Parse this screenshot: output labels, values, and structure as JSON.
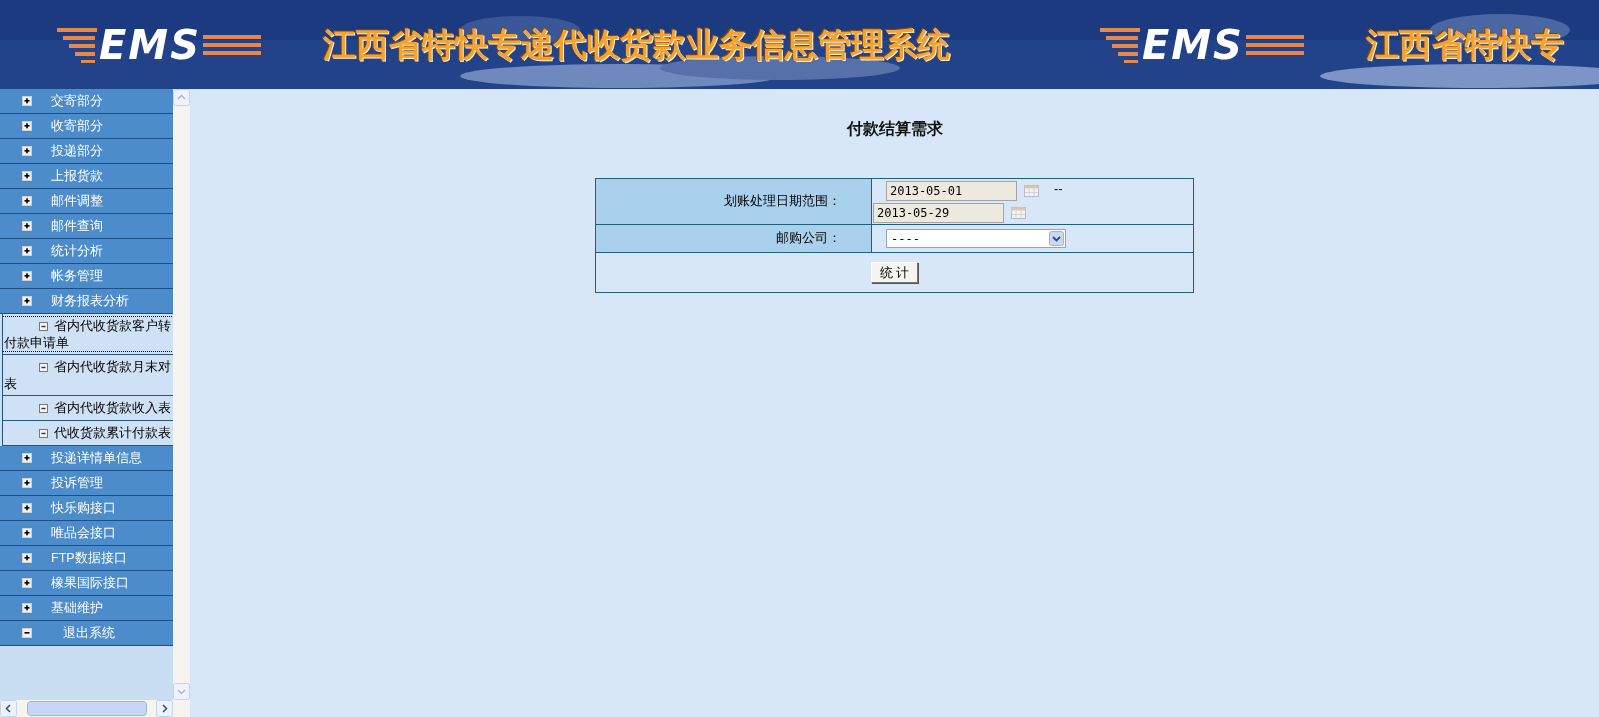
{
  "header": {
    "banners": [
      {
        "logo": "EMS",
        "title": "江西省特快专递代收货款业务信息管理系统"
      },
      {
        "logo": "EMS",
        "title": "江西省特快专"
      }
    ]
  },
  "sidebar": {
    "items": [
      {
        "label": "交寄部分",
        "expanded": false
      },
      {
        "label": "收寄部分",
        "expanded": false
      },
      {
        "label": "投递部分",
        "expanded": false
      },
      {
        "label": "上报货款",
        "expanded": false
      },
      {
        "label": "邮件调整",
        "expanded": false
      },
      {
        "label": "邮件查询",
        "expanded": false
      },
      {
        "label": "统计分析",
        "expanded": false
      },
      {
        "label": "帐务管理",
        "expanded": false
      },
      {
        "label": "财务报表分析",
        "expanded": false,
        "children": [
          {
            "lines": [
              "省内代收货款客户转",
              "付款申请单"
            ],
            "focused": true
          },
          {
            "lines": [
              "省内代收货款月末对",
              "表"
            ],
            "focused": false
          },
          {
            "lines": [
              "省内代收货款收入表"
            ],
            "focused": false
          },
          {
            "lines": [
              "代收货款累计付款表"
            ],
            "focused": false
          }
        ]
      },
      {
        "label": "投递详情单信息",
        "expanded": false
      },
      {
        "label": "投诉管理",
        "expanded": false
      },
      {
        "label": "快乐购接口",
        "expanded": false
      },
      {
        "label": "唯品会接口",
        "expanded": false
      },
      {
        "label": "FTP数据接口",
        "expanded": false
      },
      {
        "label": "橡果国际接口",
        "expanded": false
      },
      {
        "label": "基础维护",
        "expanded": false
      },
      {
        "label": "退出系统",
        "expanded": true
      }
    ]
  },
  "form": {
    "title": "付款结算需求",
    "date_range": {
      "label": "划账处理日期范围：",
      "start": "2013-05-01",
      "separator": "--",
      "end": "2013-05-29"
    },
    "company": {
      "label": "邮购公司：",
      "value": "----"
    },
    "submit": "统 计"
  }
}
